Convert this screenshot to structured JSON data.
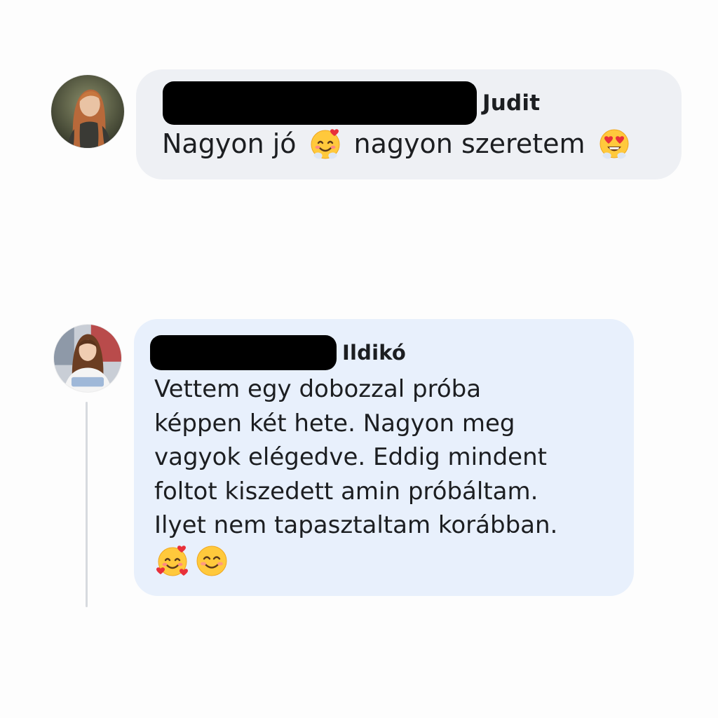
{
  "colors": {
    "bubble_1_bg": "#eef0f4",
    "bubble_2_bg": "#e8f0fc",
    "text": "#1c1e21",
    "thread_line": "#d7dadf",
    "redaction": "#000000"
  },
  "comments": [
    {
      "author": "Judit",
      "avatar_icon": "woman-long-red-hair-avatar",
      "message_part_1": "Nagyon jó",
      "emoji_1": "smiling-face-with-hearts",
      "message_part_2": "nagyon szeretem",
      "emoji_2": "heart-eyes-face"
    },
    {
      "author": "Ildikó",
      "avatar_icon": "woman-brown-hair-avatar",
      "message_lines": [
        "Vettem egy dobozzal próba",
        "képpen két hete. Nagyon meg",
        "vagyok elégedve. Eddig mindent",
        "foltot kiszedett amin próbáltam.",
        "Ilyet nem tapasztaltam korábban."
      ],
      "emojis": [
        "smiling-face-with-hearts",
        "smiling-face-with-smiling-eyes"
      ]
    }
  ]
}
